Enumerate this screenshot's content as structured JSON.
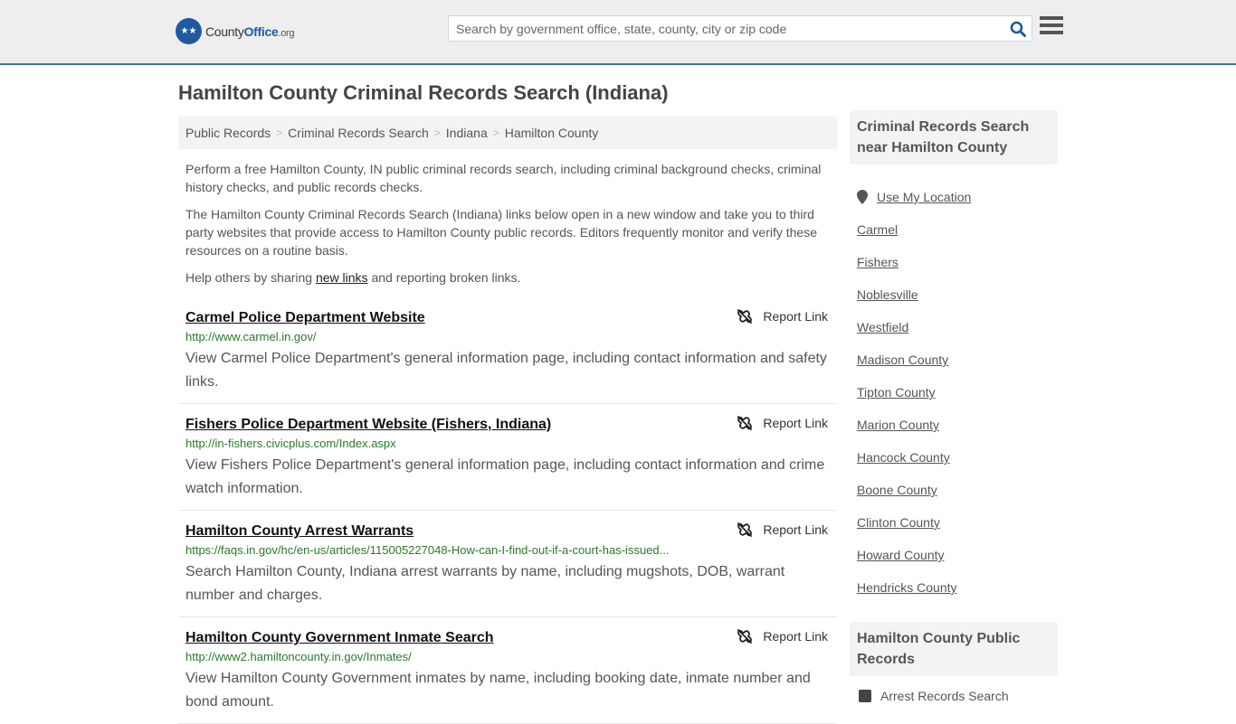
{
  "header": {
    "logo": {
      "county": "County",
      "office": "Office",
      "org": ".org"
    },
    "search_placeholder": "Search by government office, state, county, city or zip code",
    "colors": {
      "accent": "#3a76aa",
      "brand": "#1f5aa0"
    }
  },
  "page": {
    "title": "Hamilton County Criminal Records Search (Indiana)",
    "breadcrumb": [
      "Public Records",
      "Criminal Records Search",
      "Indiana",
      "Hamilton County"
    ],
    "intro": {
      "p1": "Perform a free Hamilton County, IN public criminal records search, including criminal background checks, criminal history checks, and public records checks.",
      "p2": "The Hamilton County Criminal Records Search (Indiana) links below open in a new window and take you to third party websites that provide access to Hamilton County public records. Editors frequently monitor and verify these resources on a routine basis.",
      "p3_before": "Help others by sharing ",
      "p3_link": "new links",
      "p3_after": " and reporting broken links."
    },
    "report_label": "Report Link",
    "results": [
      {
        "title": "Carmel Police Department Website",
        "url": "http://www.carmel.in.gov/",
        "desc": "View Carmel Police Department's general information page, including contact information and safety links."
      },
      {
        "title": "Fishers Police Department Website (Fishers, Indiana)",
        "url": "http://in-fishers.civicplus.com/Index.aspx",
        "desc": "View Fishers Police Department's general information page, including contact information and crime watch information."
      },
      {
        "title": "Hamilton County Arrest Warrants",
        "url": "https://faqs.in.gov/hc/en-us/articles/115005227048-How-can-I-find-out-if-a-court-has-issued...",
        "desc": "Search Hamilton County, Indiana arrest warrants by name, including mugshots, DOB, warrant number and charges."
      },
      {
        "title": "Hamilton County Government Inmate Search",
        "url": "http://www2.hamiltoncounty.in.gov/Inmates/",
        "desc": "View Hamilton County Government inmates by name, including booking date, inmate number and bond amount."
      }
    ]
  },
  "sidebar": {
    "nearby_title": "Criminal Records Search near Hamilton County",
    "use_location": "Use My Location",
    "nearby": [
      "Carmel",
      "Fishers",
      "Noblesville",
      "Westfield",
      "Madison County",
      "Tipton County",
      "Marion County",
      "Hancock County",
      "Boone County",
      "Clinton County",
      "Howard County",
      "Hendricks County"
    ],
    "public_records_title": "Hamilton County Public Records",
    "public_records": [
      "Arrest Records Search"
    ]
  }
}
